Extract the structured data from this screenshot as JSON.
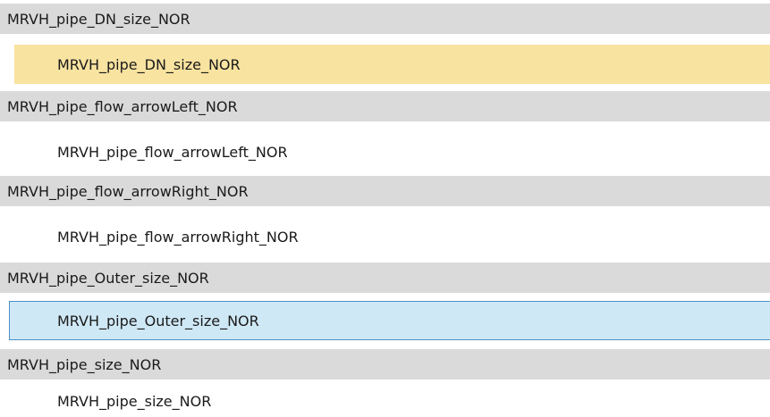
{
  "groups": [
    {
      "header": "MRVH_pipe_DN_size_NOR",
      "item": "MRVH_pipe_DN_size_NOR",
      "item_state": "highlighted"
    },
    {
      "header": "MRVH_pipe_flow_arrowLeft_NOR",
      "item": "MRVH_pipe_flow_arrowLeft_NOR",
      "item_state": "normal"
    },
    {
      "header": "MRVH_pipe_flow_arrowRight_NOR",
      "item": "MRVH_pipe_flow_arrowRight_NOR",
      "item_state": "normal"
    },
    {
      "header": "MRVH_pipe_Outer_size_NOR",
      "item": "MRVH_pipe_Outer_size_NOR",
      "item_state": "selected"
    },
    {
      "header": "MRVH_pipe_size_NOR",
      "item": "MRVH_pipe_size_NOR",
      "item_state": "normal"
    }
  ],
  "colors": {
    "group_header_bg": "#dadada",
    "highlight_bg": "#f8e3a0",
    "selected_bg": "#cfe8f6",
    "selected_border": "#4a90c8"
  }
}
